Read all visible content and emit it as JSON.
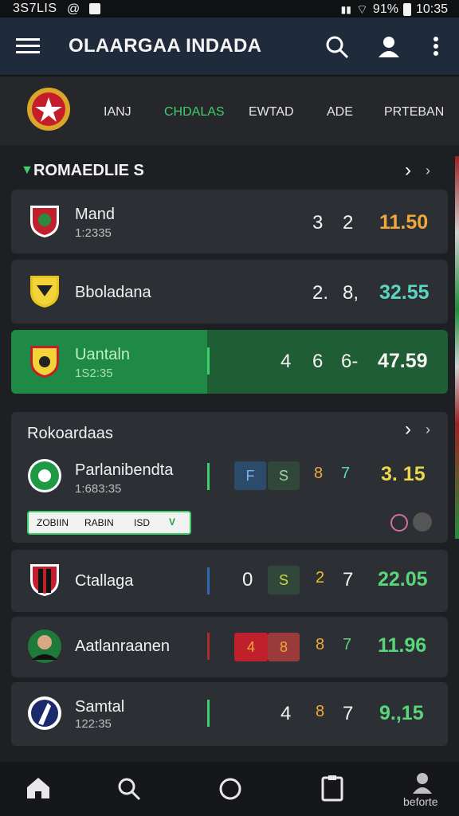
{
  "status_bar": {
    "left_text": "3S7LIS",
    "battery": "91%",
    "time": "10:35"
  },
  "app_bar": {
    "title": "OLAARGAA INDADA",
    "menu_icon": "hamburger-icon",
    "search_icon": "search-icon",
    "profile_icon": "profile-icon",
    "more_icon": "more-vert-icon"
  },
  "tabs": [
    "IANJ",
    "CHDALAS",
    "EWTAD",
    "ADE",
    "PRTEBAN"
  ],
  "section1": {
    "title": "ROMAEDLIE S",
    "matches": [
      {
        "name": "Mand",
        "time": "1:2335",
        "a": "3",
        "b": "2",
        "odd": "11.50"
      },
      {
        "name": "Bboladana",
        "time": "",
        "a": "2.",
        "b": "8,",
        "odd": "32.55"
      },
      {
        "name": "Uantaln",
        "time": "1S2:35",
        "a": "4",
        "b": "6",
        "c": "6-",
        "odd": "47.59"
      }
    ]
  },
  "section2": {
    "title": "Rokoardaas",
    "match": {
      "name": "Parlanibendta",
      "time": "1:683:35",
      "box1": "F",
      "box2": "S",
      "b": "8",
      "c": "7",
      "odd": "3. 15"
    },
    "chip": {
      "t1": "ZOBIIN",
      "t2": "RABIN",
      "t3": "ISD",
      "t4": "V"
    }
  },
  "matches_more": [
    {
      "name": "Ctallaga",
      "time": "",
      "a": "0",
      "box": "S",
      "b": "2",
      "c": "7",
      "odd": "22.05"
    },
    {
      "name": "Aatlanraanen",
      "time": "",
      "box1": "4",
      "box2": "8",
      "b": "8",
      "c": "7",
      "odd": "11.96"
    },
    {
      "name": "Samtal",
      "time": "122:35",
      "a": "4",
      "b": "8",
      "c": "7",
      "odd": "9.,15"
    }
  ],
  "bottom_nav": {
    "label": "beforte"
  },
  "colors": {
    "accent_green": "#3fcf6b",
    "orange": "#f0a83a",
    "yellow": "#e8d84a",
    "teal": "#5ad6c1"
  }
}
